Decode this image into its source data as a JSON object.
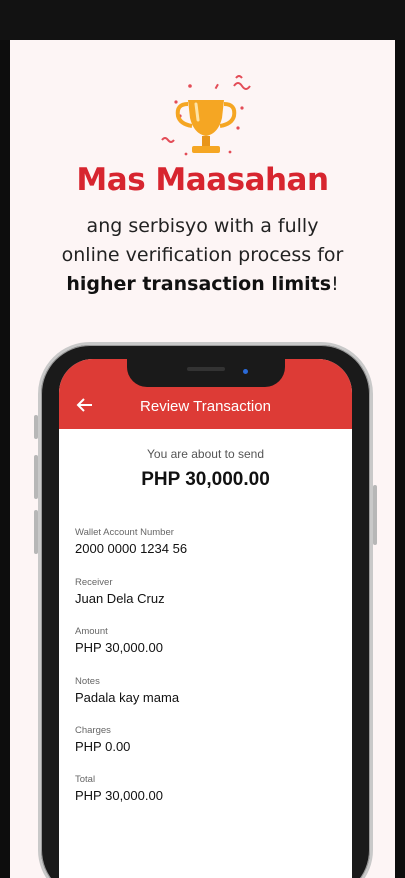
{
  "promo": {
    "headline": "Mas Maasahan",
    "line1": "ang serbisyo with a fully",
    "line2": "online verification process for",
    "line3_bold": "higher transaction limits",
    "line3_tail": "!"
  },
  "app": {
    "title": "Review Transaction",
    "about_text": "You are about to send",
    "amount_display": "PHP 30,000.00",
    "fields": [
      {
        "label": "Wallet Account Number",
        "value": "2000 0000 1234 56"
      },
      {
        "label": "Receiver",
        "value": "Juan Dela Cruz"
      },
      {
        "label": "Amount",
        "value": "PHP 30,000.00"
      },
      {
        "label": "Notes",
        "value": "Padala kay mama"
      },
      {
        "label": "Charges",
        "value": "PHP 0.00"
      },
      {
        "label": "Total",
        "value": "PHP 30,000.00"
      }
    ]
  },
  "colors": {
    "brand_red": "#d7252f",
    "appbar_red": "#dd3b36",
    "trophy_gold": "#f5a623",
    "background": "#fdf5f5"
  },
  "icons": {
    "trophy": "trophy-icon",
    "back": "arrow-left-icon"
  }
}
